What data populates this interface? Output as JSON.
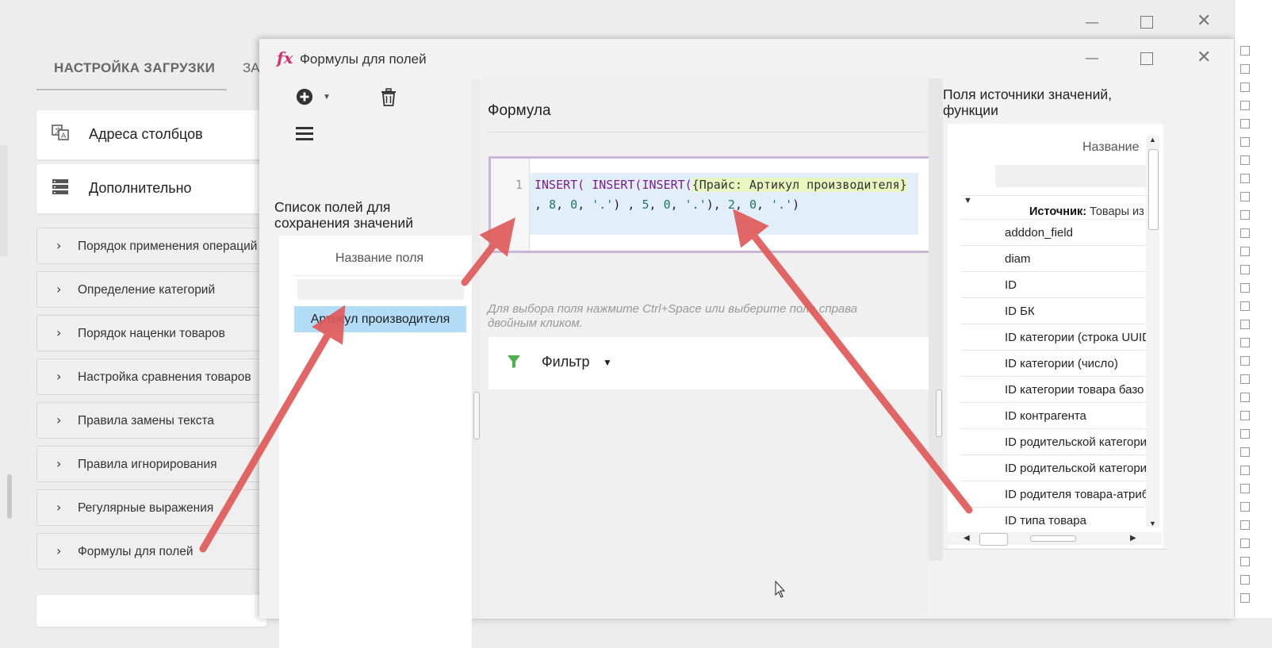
{
  "bg": {
    "tab_active": "НАСТРОЙКА ЗАГРУЗКИ",
    "tab_other": "ЗА",
    "card_columns": "Адреса столбцов",
    "card_more": "Дополнительно",
    "accordion": [
      "Порядок применения операций",
      "Определение категорий",
      "Порядок наценки товаров",
      "Настройка сравнения товаров",
      "Правила замены текста",
      "Правила игнорирования",
      "Регулярные выражения",
      "Формулы для полей"
    ]
  },
  "dialog": {
    "icon": "fx",
    "title": "Формулы для полей",
    "toolbar": {
      "add_icon": "plus-circle-icon",
      "delete_icon": "trash-icon",
      "menu_icon": "hamburger-icon"
    },
    "left": {
      "title": "Список полей для сохранения значений",
      "column_header": "Название поля",
      "rows": [
        "Артикул производителя"
      ]
    },
    "center": {
      "title": "Формула",
      "line_number": "1",
      "code": {
        "t1": "INSERT(",
        "t2": " ",
        "t3": "INSERT(",
        "t4": "INSERT(",
        "t5": "{Прайс: Артикул производителя}",
        "t6": " , ",
        "t7": "8",
        "t8": ", ",
        "t9": "0",
        "t10": ", ",
        "t11": "'.'",
        "t12": ") , ",
        "t13": "5",
        "t14": ", ",
        "t15": "0",
        "t16": ", ",
        "t17": "'.'",
        "t18": "), ",
        "t19": "2",
        "t20": ", ",
        "t21": "0",
        "t22": ", ",
        "t23": "'.'",
        "t24": ")"
      },
      "hint": "Для выбора поля нажмите Ctrl+Space или выберите поле справа двойным кликом.",
      "filter_label": "Фильтр"
    },
    "right": {
      "title": "Поля источники значений, функции",
      "column_header": "Название",
      "group_label": "Источник:",
      "group_value": "Товары из",
      "rows": [
        "adddon_field",
        "diam",
        "ID",
        "ID БК",
        "ID категории (строка UUID",
        "ID категории (число)",
        "ID категории товара базо",
        "ID контрагента",
        "ID родительской категори",
        "ID родительской категори",
        "ID родителя товара-атриб",
        "ID типа товара"
      ]
    }
  },
  "colors": {
    "accent_fx": "#d42f6a",
    "selected_row": "#b3dcf7",
    "arrow": "#e05a5a",
    "filter_icon": "#4caf50"
  }
}
